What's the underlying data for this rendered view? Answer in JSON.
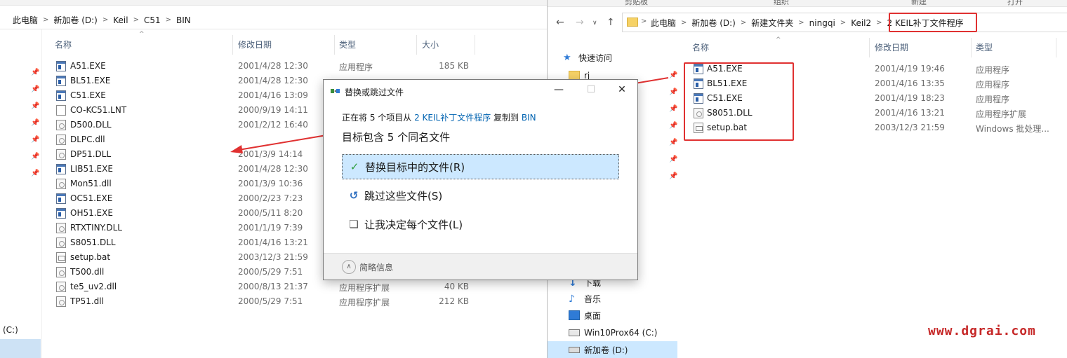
{
  "left_window": {
    "ribbon": {},
    "breadcrumb": [
      "此电脑",
      "新加卷 (D:)",
      "Keil",
      "C51",
      "BIN"
    ],
    "columns": {
      "name": "名称",
      "date": "修改日期",
      "type": "类型",
      "size": "大小"
    },
    "files": [
      {
        "name": "A51.EXE",
        "date": "2001/4/28 12:30",
        "type": "应用程序",
        "size": "185 KB",
        "icon": "exe-icon"
      },
      {
        "name": "BL51.EXE",
        "date": "2001/4/28 12:30",
        "type": "",
        "size": "",
        "icon": "exe-icon"
      },
      {
        "name": "C51.EXE",
        "date": "2001/4/16 13:09",
        "type": "",
        "size": "",
        "icon": "exe-icon"
      },
      {
        "name": "CO-KC51.LNT",
        "date": "2000/9/19 14:11",
        "type": "",
        "size": "",
        "icon": "document-icon"
      },
      {
        "name": "D500.DLL",
        "date": "2001/2/12 16:40",
        "type": "",
        "size": "",
        "icon": "dll-icon"
      },
      {
        "name": "DLPC.dll",
        "date": "",
        "type": "",
        "size": "",
        "icon": "dll-icon"
      },
      {
        "name": "DP51.DLL",
        "date": "2001/3/9 14:14",
        "type": "",
        "size": "",
        "icon": "dll-icon"
      },
      {
        "name": "LIB51.EXE",
        "date": "2001/4/28 12:30",
        "type": "",
        "size": "",
        "icon": "exe-icon"
      },
      {
        "name": "Mon51.dll",
        "date": "2001/3/9 10:36",
        "type": "",
        "size": "",
        "icon": "dll-icon"
      },
      {
        "name": "OC51.EXE",
        "date": "2000/2/23 7:23",
        "type": "",
        "size": "",
        "icon": "exe-icon"
      },
      {
        "name": "OH51.EXE",
        "date": "2000/5/11 8:20",
        "type": "",
        "size": "",
        "icon": "exe-icon"
      },
      {
        "name": "RTXTINY.DLL",
        "date": "2001/1/19 7:39",
        "type": "",
        "size": "",
        "icon": "dll-icon"
      },
      {
        "name": "S8051.DLL",
        "date": "2001/4/16 13:21",
        "type": "",
        "size": "",
        "icon": "dll-icon"
      },
      {
        "name": "setup.bat",
        "date": "2003/12/3 21:59",
        "type": "",
        "size": "",
        "icon": "batch-file-icon"
      },
      {
        "name": "T500.dll",
        "date": "2000/5/29 7:51",
        "type": "",
        "size": "",
        "icon": "dll-icon"
      },
      {
        "name": "te5_uv2.dll",
        "date": "2000/8/13 21:37",
        "type": "应用程序扩展",
        "size": "40 KB",
        "icon": "dll-icon"
      },
      {
        "name": "TP51.dll",
        "date": "2000/5/29 7:51",
        "type": "应用程序扩展",
        "size": "212 KB",
        "icon": "dll-icon"
      }
    ],
    "nav_bottom_label": "(C:)"
  },
  "right_window": {
    "ribbon": {
      "labels": [
        "剪贴板",
        "组织",
        "新建",
        "打开"
      ]
    },
    "breadcrumb": [
      "此电脑",
      "新加卷 (D:)",
      "新建文件夹",
      "ningqi",
      "Keil2",
      "2 KEIL补丁文件程序"
    ],
    "columns": {
      "name": "名称",
      "date": "修改日期",
      "type": "类型"
    },
    "nav": {
      "quick_access": "快速访问",
      "rj": "rj",
      "downloads": "下载",
      "music": "音乐",
      "desktop": "桌面",
      "c_drive": "Win10Prox64 (C:)",
      "d_drive": "新加卷 (D:)"
    },
    "files": [
      {
        "name": "A51.EXE",
        "date": "2001/4/19 19:46",
        "type": "应用程序",
        "icon": "exe-icon"
      },
      {
        "name": "BL51.EXE",
        "date": "2001/4/16 13:35",
        "type": "应用程序",
        "icon": "exe-icon"
      },
      {
        "name": "C51.EXE",
        "date": "2001/4/19 18:23",
        "type": "应用程序",
        "icon": "exe-icon"
      },
      {
        "name": "S8051.DLL",
        "date": "2001/4/16 13:21",
        "type": "应用程序扩展",
        "icon": "dll-icon"
      },
      {
        "name": "setup.bat",
        "date": "2003/12/3 21:59",
        "type": "Windows 批处理...",
        "icon": "batch-file-icon"
      }
    ]
  },
  "dialog": {
    "title": "替换或跳过文件",
    "sub_prefix": "正在将 5 个项目从 ",
    "sub_source": "2 KEIL补丁文件程序",
    "sub_middle": " 复制到 ",
    "sub_dest": "BIN",
    "heading": "目标包含 5 个同名文件",
    "options": {
      "replace": "替换目标中的文件(R)",
      "skip": "跳过这些文件(S)",
      "decide": "让我决定每个文件(L)"
    },
    "footer": "简略信息"
  },
  "watermark": "www.dgrai.com",
  "colors": {
    "annotation_red": "#e03131",
    "selection_blue": "#cce8ff",
    "link_blue": "#0063b1",
    "check_green": "#2e9e3e"
  }
}
